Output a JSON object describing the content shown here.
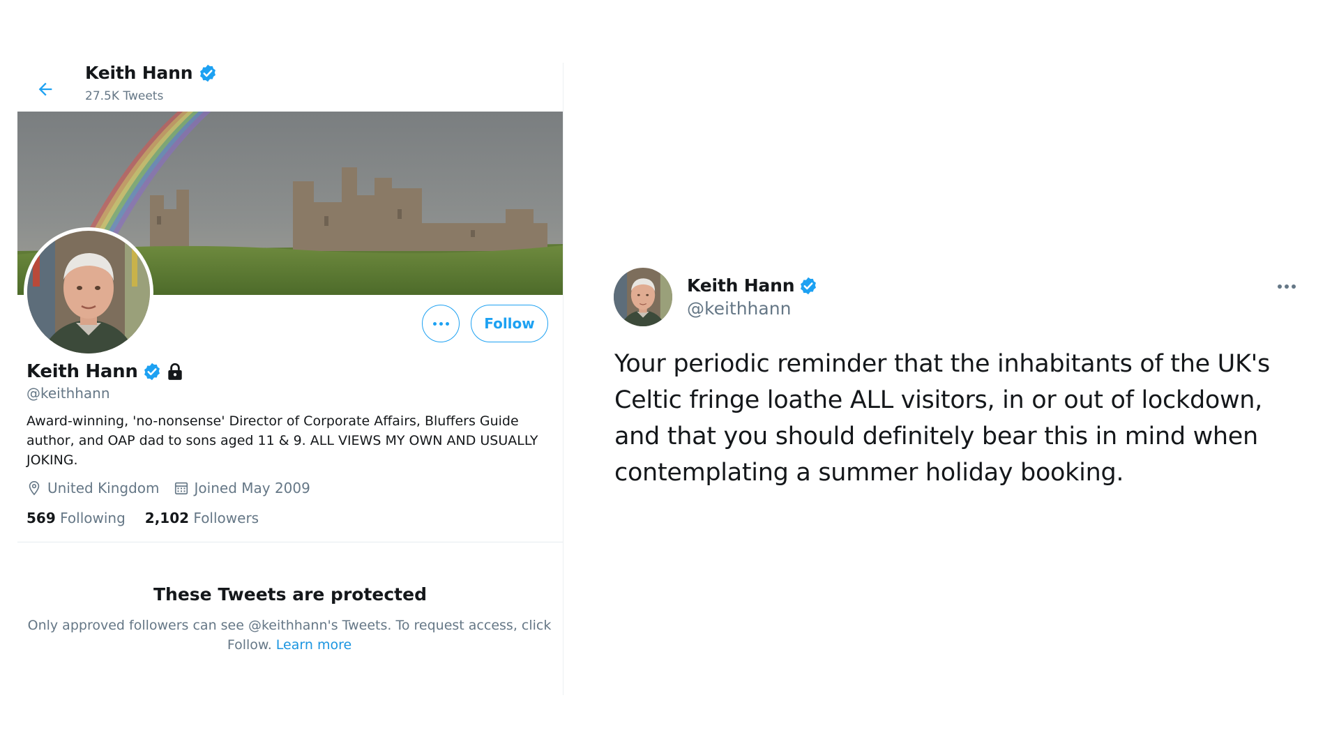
{
  "profile_header": {
    "name": "Keith Hann",
    "tweet_count": "27.5K Tweets"
  },
  "profile": {
    "name": "Keith Hann",
    "handle": "@keithhann",
    "bio": "Award-winning, 'no-nonsense' Director of Corporate Affairs, Bluffers Guide author, and OAP dad to sons aged 11 & 9. ALL VIEWS MY OWN AND USUALLY JOKING.",
    "location": "United Kingdom",
    "joined": "Joined May 2009",
    "following_count": "569",
    "following_label": "Following",
    "followers_count": "2,102",
    "followers_label": "Followers",
    "follow_button": "Follow"
  },
  "protected_notice": {
    "title": "These Tweets are protected",
    "message": "Only approved followers can see @keithhann's Tweets. To request access, click Follow.",
    "link_text": "Learn more"
  },
  "tweet": {
    "name": "Keith Hann",
    "handle": "@keithhann",
    "text": "Your periodic reminder that the inhabitants of the UK's Celtic fringe loathe ALL visitors, in or out of lockdown, and that you should definitely bear this in mind when contemplating a summer holiday booking."
  },
  "colors": {
    "accent": "#1da1f2",
    "secondary_text": "#657786",
    "primary_text": "#14171a"
  },
  "icons": [
    "back-arrow-icon",
    "verified-badge-icon",
    "lock-icon",
    "location-pin-icon",
    "calendar-icon",
    "more-options-icon"
  ]
}
